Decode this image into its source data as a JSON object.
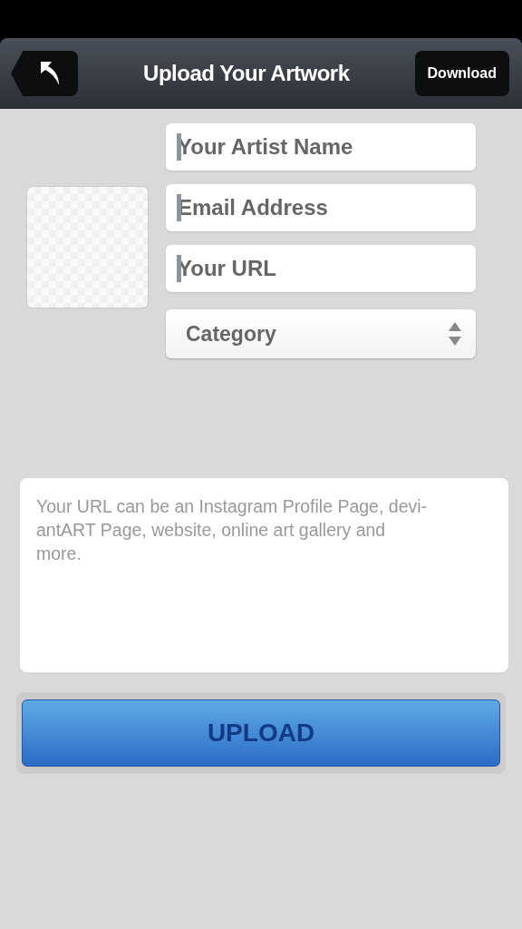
{
  "nav_bar": {
    "title": "Upload Your Artwork",
    "action_button": "Download"
  },
  "fields": [
    {
      "placeholder": "Your Artist Name",
      "focused": true
    },
    {
      "placeholder": "Email Address",
      "focused": true
    },
    {
      "placeholder": "Your URL",
      "focused": true
    }
  ],
  "category_select": {
    "placeholder": "Category"
  },
  "note": {
    "lines": [
      "Your URL can be an Instagram Profile Page, devi-",
      "antART Page, website, online art gallery and",
      "more."
    ]
  },
  "upload_button": "UPLOAD"
}
